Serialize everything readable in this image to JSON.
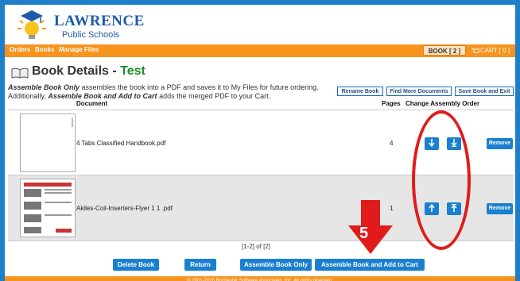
{
  "header": {
    "logo_title": "LAWRENCE",
    "logo_subtitle": "Public Schools"
  },
  "nav": {
    "items": [
      "Orders",
      "Books",
      "Manage Files"
    ],
    "book_tab": "BOOK [ 2 ]",
    "cart_tab": "CART [ 0 ]"
  },
  "page": {
    "title_prefix": "Book Details - ",
    "book_name": "Test",
    "desc_bold1": "Assemble Book Only",
    "desc_text1": " assembles the book into a PDF and saves it to My Files for future ordering.",
    "desc_text2": "Additionally, ",
    "desc_bold2": "Assemble Book and Add to Cart",
    "desc_text3": " adds the merged PDF to your Cart."
  },
  "toolbar": {
    "rename": "Rename Book",
    "find_more": "Find More Documents",
    "save_exit": "Save Book and Exit"
  },
  "table": {
    "headers": [
      "Document",
      "Pages",
      "Change Assembly Order"
    ],
    "rows": [
      {
        "document": "4 Tabs Classified Handbook.pdf",
        "pages": "4"
      },
      {
        "document": "Akiles-Coil-Inserters-Flyer 1 1 .pdf",
        "pages": "1"
      }
    ],
    "remove_label": "Remove"
  },
  "pager": "[1-2] of [2]",
  "buttons": {
    "delete": "Delete Book",
    "return": "Return",
    "assemble_only": "Assemble Book Only",
    "assemble_cart": "Assemble Book and Add to Cart"
  },
  "annotation": {
    "step_number": "5"
  },
  "footer": "© 2001-2020 Rochester Software Associates, Inc. All rights reserved.",
  "colors": {
    "frame_border": "#1e7fc8",
    "nav_orange": "#f7941d",
    "button_blue": "#1a7fd0",
    "annotation_red": "#e11b1b",
    "title_green": "#1a8a2a"
  }
}
